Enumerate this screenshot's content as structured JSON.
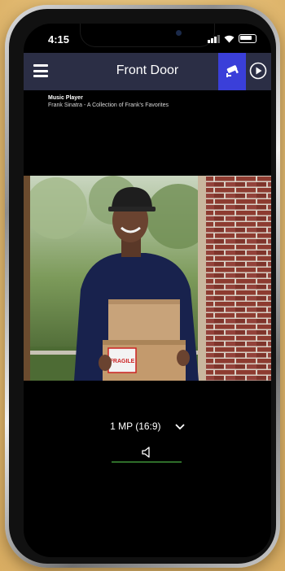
{
  "status_bar": {
    "time": "4:15"
  },
  "header": {
    "title": "Front Door"
  },
  "music": {
    "title": "Music Player",
    "subtitle": "Frank Sinatra - A Collection of Frank's Favorites"
  },
  "video": {
    "box_label": "FRAGILE"
  },
  "controls": {
    "resolution": "1 MP (16:9)"
  },
  "icons": {
    "menu": "menu-icon",
    "camera": "security-camera-icon",
    "play": "play-circle-icon",
    "chevron": "chevron-down-icon",
    "volume": "speaker-icon"
  },
  "colors": {
    "header_bg": "#2b2e45",
    "camera_button_bg": "#3a3fd9",
    "volume_bar": "#2f6e2a"
  }
}
